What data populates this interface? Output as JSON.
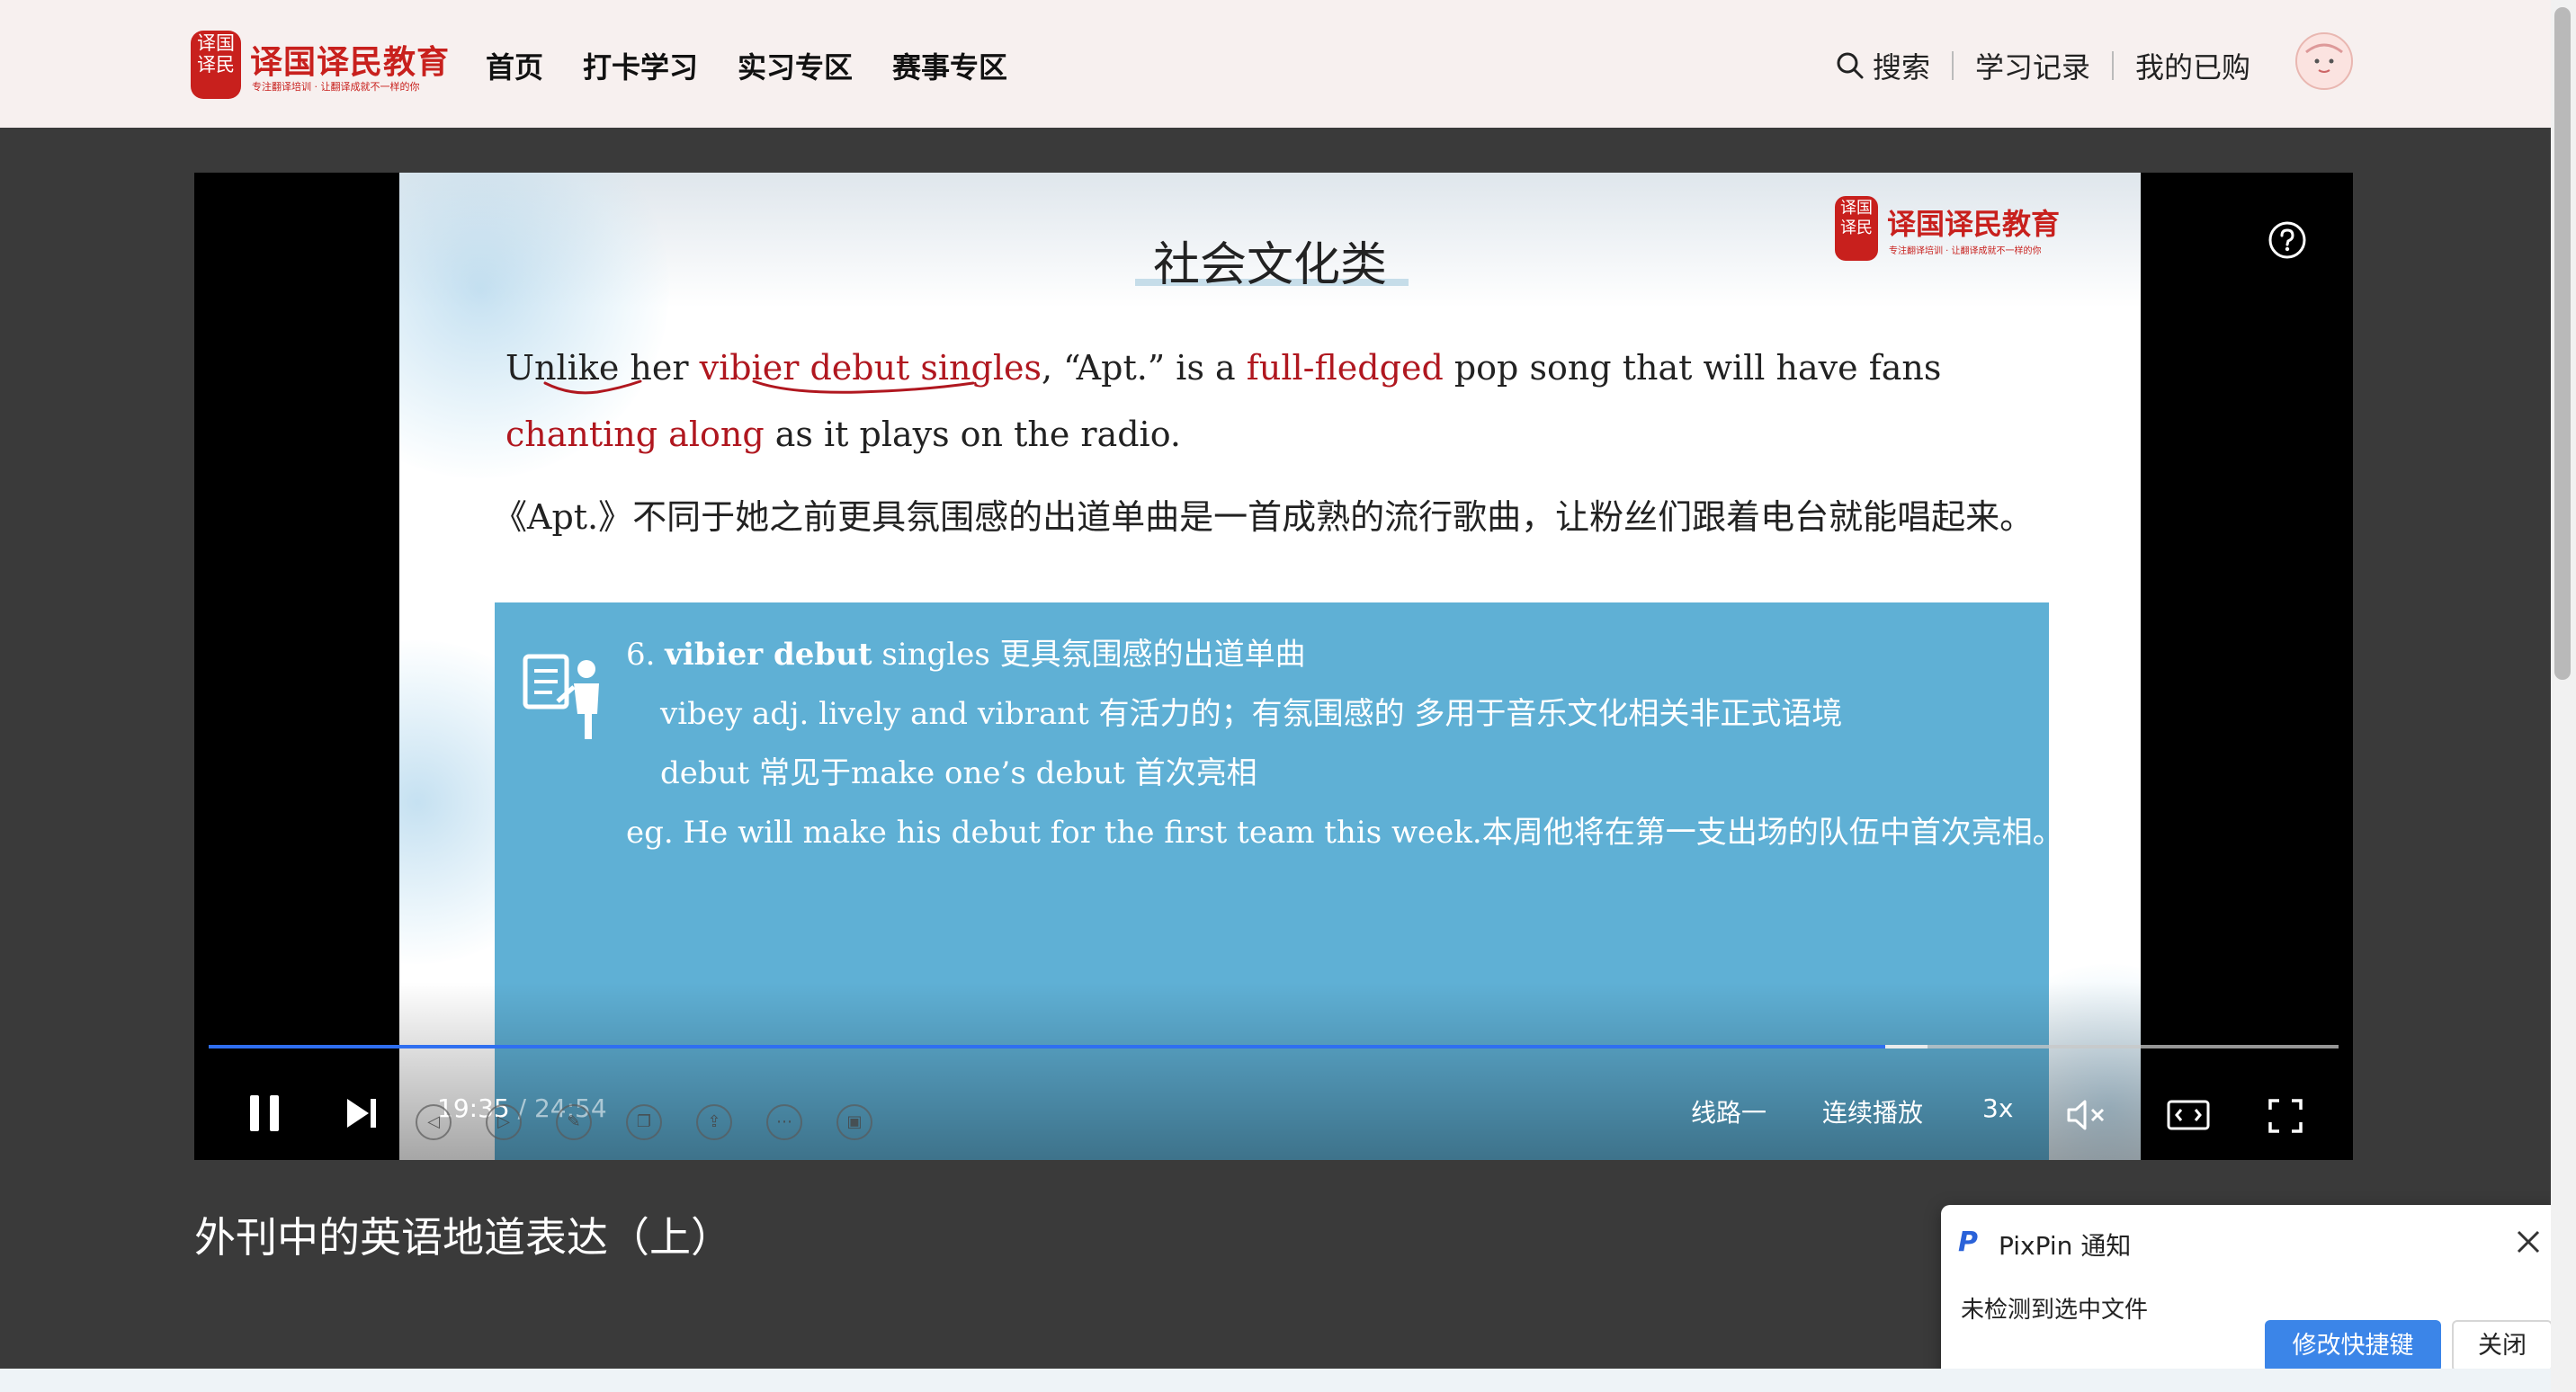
{
  "brand": {
    "name": "译国译民教育",
    "seal": "译国译民",
    "tagline": "专注翻译培训 · 让翻译成就不一样的你"
  },
  "nav": {
    "items": [
      "首页",
      "打卡学习",
      "实习专区",
      "赛事专区"
    ],
    "search_label": "搜索",
    "history_label": "学习记录",
    "purchased_label": "我的已购"
  },
  "slide": {
    "title": "社会文化类",
    "logo_name": "译国译民教育",
    "logo_seal": "译国译民",
    "logo_tag": "专注翻译培训 · 让翻译成就不一样的你",
    "en_parts": {
      "p1": "Unlike her ",
      "h1": "vibier debut singles",
      "p2": ", “Apt.” is a ",
      "h2": "full-fledged",
      "p3": " pop song that will have fans ",
      "h3": "chanting along",
      "p4": " as it plays on the radio."
    },
    "zh": "《Apt.》不同于她之前更具氛围感的出道单曲是一首成熟的流行歌曲，让粉丝们跟着电台就能唱起来。",
    "note": {
      "l1_prefix": "6. ",
      "l1_bold": "vibier debut",
      "l1_rest": " singles 更具氛围感的出道单曲",
      "l2": "vibey adj. lively and vibrant 有活力的；有氛围感的 多用于音乐文化相关非正式语境",
      "l3": "debut 常见于make one’s debut 首次亮相",
      "l4": "eg. He will make his debut for the first team this week.本周他将在第一支出场的队伍中首次亮相。"
    }
  },
  "player": {
    "current_time": "19:35",
    "separator": " / ",
    "total_time": "24:54",
    "progress": 0.787,
    "buffered": 0.807,
    "route_label": "线路一",
    "autoplay_label": "连续播放",
    "speed_label": "3x"
  },
  "video_title": "外刊中的英语地道表达（上）",
  "toast": {
    "app_name": "PixPin 通知",
    "message": "未检测到选中文件",
    "primary_button": "修改快捷键",
    "secondary_button": "关闭"
  },
  "colors": {
    "brand_red": "#c8201d",
    "highlight_red": "#b0171f",
    "note_blue": "#5fb0d5",
    "progress_blue": "#2f6ff0",
    "toast_button_blue": "#3b85e8"
  }
}
